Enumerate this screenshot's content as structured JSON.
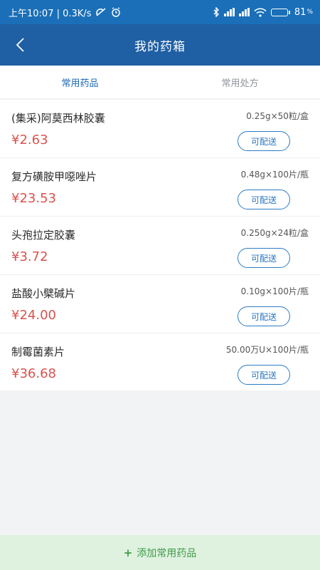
{
  "status_bar": {
    "left": "上午10:07 | 0.3K/s",
    "battery": "81",
    "battery_pct": 81,
    "accent": "#1a6fb8"
  },
  "header": {
    "title": "我的药箱",
    "back_icon": "chevron-left-icon",
    "color": "#1f5fa3"
  },
  "tabs": [
    {
      "label": "常用药品",
      "active": true
    },
    {
      "label": "常用处方",
      "active": false
    }
  ],
  "medicines": [
    {
      "name": "(集采)阿莫西林胶囊",
      "spec": "0.25g×50粒/盒",
      "price": "¥2.63",
      "badge": "可配送"
    },
    {
      "name": "复方磺胺甲噁唑片",
      "spec": "0.48g×100片/瓶",
      "price": "¥23.53",
      "badge": "可配送"
    },
    {
      "name": "头孢拉定胶囊",
      "spec": "0.250g×24粒/盒",
      "price": "¥3.72",
      "badge": "可配送"
    },
    {
      "name": "盐酸小檗碱片",
      "spec": "0.10g×100片/瓶",
      "price": "¥24.00",
      "badge": "可配送"
    },
    {
      "name": "制霉菌素片",
      "spec": "50.00万U×100片/瓶",
      "price": "¥36.68",
      "badge": "可配送"
    }
  ],
  "footer": {
    "plus": "+",
    "label": "添加常用药品"
  },
  "colors": {
    "price": "#d9534f",
    "badge": "#2c7cc4",
    "footer_bg": "#dff2df",
    "footer_text": "#3f9a4a"
  }
}
